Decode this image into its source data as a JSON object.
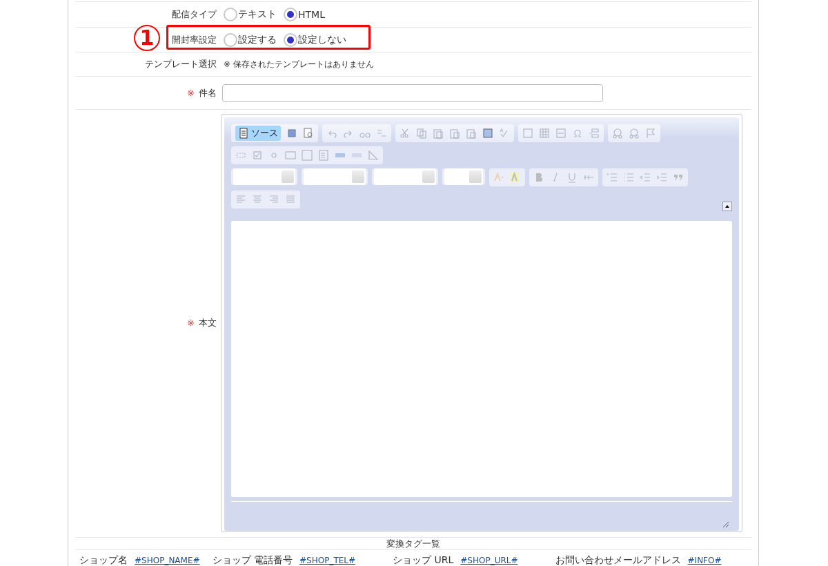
{
  "rows": [
    {
      "kind": "radio",
      "label": "配信タイプ",
      "options": [
        {
          "label": "テキスト",
          "selected": false
        },
        {
          "label": "HTML",
          "selected": true
        }
      ]
    },
    {
      "kind": "radio",
      "label": "開封率設定",
      "annotation": "1",
      "options": [
        {
          "label": "設定する",
          "selected": false
        },
        {
          "label": "設定しない",
          "selected": true
        }
      ]
    },
    {
      "kind": "note",
      "label": "テンプレート選択",
      "text": "※ 保存されたテンプレートはありません"
    },
    {
      "kind": "input",
      "label": "件名",
      "required_mark": "※"
    },
    {
      "kind": "editor",
      "label": "本文",
      "required_mark": "※",
      "source_button": {
        "label": "ソース",
        "selected": true
      }
    }
  ],
  "tags": {
    "title": "変換タグ一覧",
    "items": [
      {
        "label": "ショップ名",
        "tag": "#SHOP_NAME#"
      },
      {
        "label": "ショップ 電話番号",
        "tag": "#SHOP_TEL#"
      },
      {
        "label": "ショップ URL",
        "tag": "#SHOP_URL#"
      },
      {
        "label": "お問い合わせメールアドレス",
        "tag": "#INFO#"
      }
    ]
  }
}
